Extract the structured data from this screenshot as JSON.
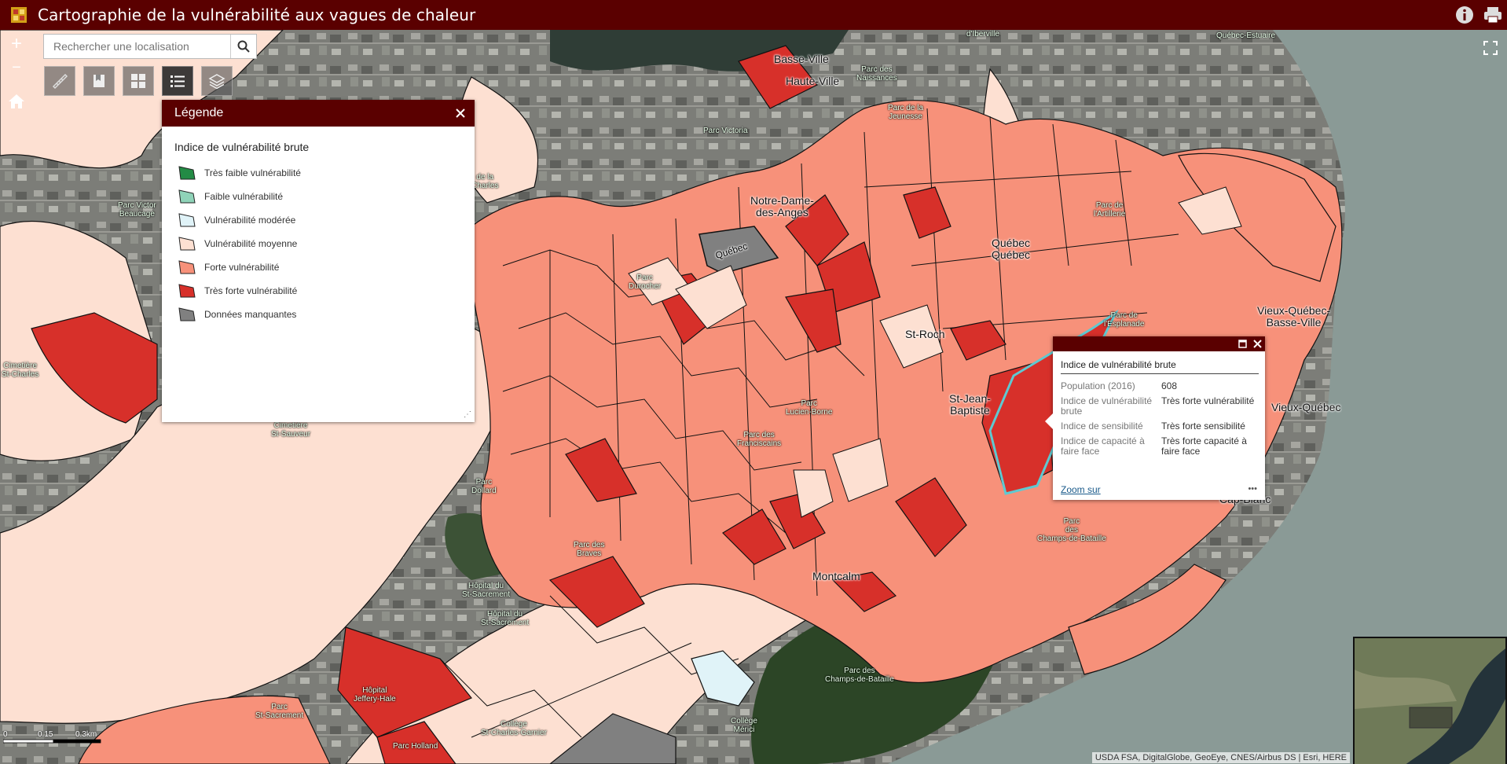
{
  "header": {
    "title": "Cartographie de la vulnérabilité aux vagues de chaleur",
    "accent": "#5a0000"
  },
  "search": {
    "placeholder": "Rechercher une localisation"
  },
  "zoom": {
    "in_label": "+",
    "out_label": "−"
  },
  "legend": {
    "title": "Légende",
    "subtitle": "Indice de vulnérabilité brute",
    "items": [
      {
        "label": "Très faible vulnérabilité",
        "color": "#238b45"
      },
      {
        "label": "Faible vulnérabilité",
        "color": "#8fd3b8"
      },
      {
        "label": "Vulnérabilité modérée",
        "color": "#e0f3f8"
      },
      {
        "label": "Vulnérabilité moyenne",
        "color": "#fde0d2"
      },
      {
        "label": "Forte vulnérabilité",
        "color": "#f7917a"
      },
      {
        "label": "Très forte vulnérabilité",
        "color": "#d7302a"
      },
      {
        "label": "Données manquantes",
        "color": "#808080"
      }
    ]
  },
  "popup": {
    "title": "Indice de vulnérabilité brute",
    "rows": [
      {
        "key": "Population (2016)",
        "value": "608"
      },
      {
        "key": "Indice de vulnérabilité brute",
        "value": "Très forte vulnérabilité"
      },
      {
        "key": "Indice de sensibilité",
        "value": "Très forte sensibilité"
      },
      {
        "key": "Indice de capacité à faire face",
        "value": "Très forte capacité à faire face"
      }
    ],
    "zoom_link": "Zoom sur",
    "more": "•••"
  },
  "map_labels": [
    "Basse-Ville",
    "Haute-Ville",
    "Parc des\nNaissances",
    "Parc de la\nJeunesse",
    "Parc Victoria",
    "Notre-Dame-\ndes-Anges",
    "Québec",
    "Parc\nDurocher",
    "Québec\nQuébec",
    "Parc de\nl'Artillerie",
    "Parc de\nl'Esplanade",
    "Vieux-Québec-\nBasse-Ville",
    "St-Roch",
    "St-Jean-\nBaptiste",
    "Vieux-Québec",
    "Parc\nLucien-Borne",
    "Parc des\nFranciscains",
    "Parc\nDollard",
    "Parc\ndes\nChamps-de-Bataille",
    "Cap-Blanc",
    "Parc des\nBraves",
    "Montcalm",
    "Hôpital du\nSt-Sacrement",
    "Hôpital du\nSt-Sacrement",
    "Hôpital\nJeffery-Hale",
    "Parc Holland",
    "Collège\nSt-Charles-Garnier",
    "Collège\nMérici",
    "Parc\nSt-Sacrement",
    "Parc des\nChamps-de-Bataille",
    "Cimetière\nSt-Sauveur",
    "Cimetière\nSt-Charles",
    "Parc Victor\nBeaucage",
    "d'Iberville",
    "Québec-Estuaire",
    "de la\nCharles"
  ],
  "scale": {
    "labels": [
      "0",
      "0.15",
      "0.3km"
    ]
  },
  "attribution": "USDA FSA, DigitalGlobe, GeoEye, CNES/Airbus DS | Esri, HERE"
}
